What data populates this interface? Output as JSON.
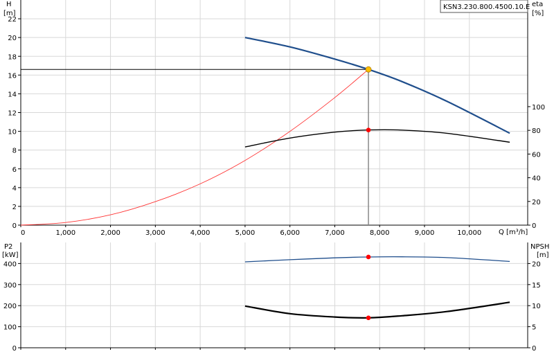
{
  "model_label": "KSN3.230.800.4500.10.E",
  "colors": {
    "head": "#1f4e8c",
    "system": "#ff3333",
    "efficiency": "#000000",
    "power": "#1f4e8c",
    "npsh": "#000000",
    "duty_point": "#ffbf00",
    "marker": "#ff0000",
    "grid": "#d8d8d8"
  },
  "chart_data": [
    {
      "type": "line",
      "name": "performance",
      "ylabel_left": {
        "line1": "H",
        "line2": "[m]"
      },
      "ylabel_right": {
        "line1": "eta",
        "line2": "[%]"
      },
      "xlabel": "Q [m³/h]",
      "xlim": [
        0,
        11300
      ],
      "ylim_left": [
        0,
        24
      ],
      "ylim_right": [
        0,
        190
      ],
      "x_ticks": [
        0,
        1000,
        2000,
        3000,
        4000,
        5000,
        6000,
        7000,
        8000,
        9000,
        10000
      ],
      "x_tick_labels": [
        "0",
        "1,000",
        "2,000",
        "3,000",
        "4,000",
        "5,000",
        "6,000",
        "7,000",
        "8,000",
        "9,000",
        "10,000"
      ],
      "y_ticks_left": [
        0,
        2,
        4,
        6,
        8,
        10,
        12,
        14,
        16,
        18,
        20,
        22
      ],
      "y_tick_labels_left": [
        "0",
        "2",
        "4",
        "6",
        "8",
        "10",
        "12",
        "14",
        "16",
        "18",
        "20",
        "22"
      ],
      "y_ticks_right": [
        0,
        20,
        40,
        60,
        80,
        100
      ],
      "y_tick_labels_right": [
        "0",
        "20",
        "40",
        "60",
        "80",
        "100"
      ],
      "grid": true,
      "duty_point": {
        "x": 7750,
        "y": 16.6
      },
      "series": [
        {
          "id": "head",
          "axis": "left",
          "x": [
            5000,
            6000,
            7000,
            7750,
            8500,
            9500,
            10900
          ],
          "y": [
            20.0,
            19.0,
            17.7,
            16.6,
            15.3,
            13.2,
            9.8
          ]
        },
        {
          "id": "system",
          "axis": "left",
          "x": [
            0,
            1000,
            2000,
            3000,
            4000,
            5000,
            6000,
            7000,
            7750
          ],
          "y": [
            0,
            0.28,
            1.1,
            2.5,
            4.4,
            6.9,
            10.0,
            13.6,
            16.6
          ]
        },
        {
          "id": "efficiency",
          "axis": "right",
          "x": [
            5000,
            6000,
            7000,
            7750,
            8500,
            9500,
            10900
          ],
          "y": [
            66,
            73.5,
            78.5,
            80.3,
            80.2,
            77.5,
            70
          ]
        }
      ],
      "markers": [
        {
          "series": "efficiency",
          "x": 7750,
          "y": 80.3
        }
      ]
    },
    {
      "type": "line",
      "name": "power-npsh",
      "ylabel_left": {
        "line1": "P2",
        "line2": "[kW]"
      },
      "ylabel_right": {
        "line1": "NPSH",
        "line2": "[m]"
      },
      "xlim": [
        0,
        11300
      ],
      "ylim_left": [
        0,
        500
      ],
      "ylim_right": [
        0,
        25
      ],
      "x_ticks": [
        0,
        1000,
        2000,
        3000,
        4000,
        5000,
        6000,
        7000,
        8000,
        9000,
        10000
      ],
      "y_ticks_left": [
        0,
        100,
        200,
        300,
        400
      ],
      "y_tick_labels_left": [
        "0",
        "100",
        "200",
        "300",
        "400"
      ],
      "y_ticks_right": [
        0,
        5,
        10,
        15,
        20
      ],
      "y_tick_labels_right": [
        "0",
        "5",
        "10",
        "15",
        "20"
      ],
      "grid": true,
      "series": [
        {
          "id": "power",
          "axis": "left",
          "x": [
            5000,
            6000,
            7000,
            7750,
            8500,
            9500,
            10900
          ],
          "y": [
            408,
            418,
            427,
            431,
            432,
            428,
            410
          ]
        },
        {
          "id": "npsh",
          "axis": "right",
          "x": [
            5000,
            6000,
            7000,
            7750,
            8500,
            9500,
            10900
          ],
          "y": [
            9.9,
            8.1,
            7.3,
            7.1,
            7.6,
            8.6,
            10.8
          ]
        }
      ],
      "markers": [
        {
          "series": "power",
          "x": 7750,
          "y": 431
        },
        {
          "series": "npsh",
          "x": 7750,
          "y": 7.1
        }
      ]
    }
  ]
}
